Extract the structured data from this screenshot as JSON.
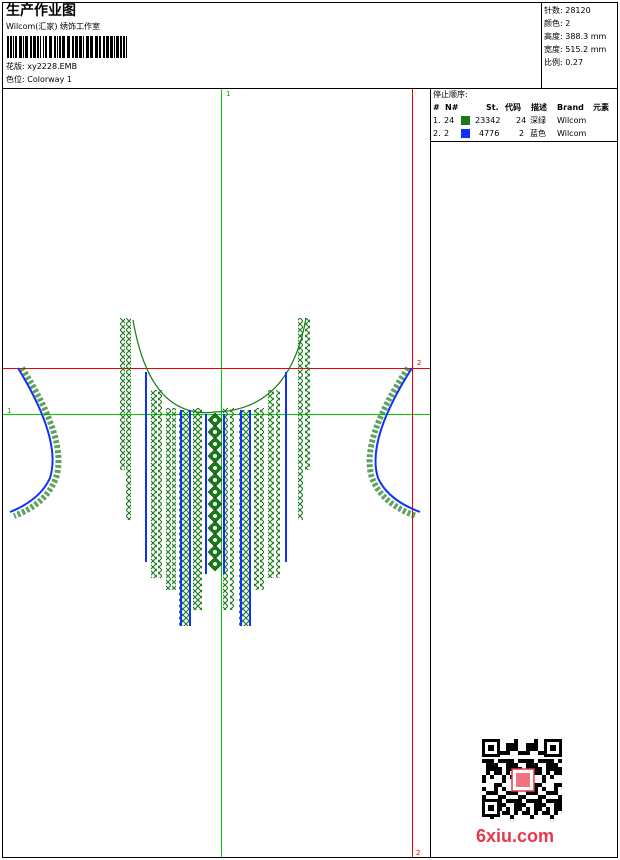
{
  "header": {
    "title": "生产作业图",
    "company": "Wilcom(汇家) 绣饰工作室",
    "design_label": "花版: ",
    "design_value": "xy2228.EMB",
    "colorway_label": "色位: ",
    "colorway_value": "Colorway 1"
  },
  "specs": [
    {
      "label": "针数:",
      "value": "28120"
    },
    {
      "label": "颜色:",
      "value": "2"
    },
    {
      "label": "高度:",
      "value": "388.3 mm"
    },
    {
      "label": "宽度:",
      "value": "515.2 mm"
    },
    {
      "label": "比例:",
      "value": "0.27"
    }
  ],
  "stop_sequence": {
    "title": "停止顺序:",
    "columns": [
      "#",
      "N#",
      "St.",
      "代码",
      "描述",
      "Brand",
      "元素"
    ],
    "rows": [
      {
        "index": "1.",
        "needle": "24",
        "swatch": "#1a7a1a",
        "stitches": "23342",
        "code": "24",
        "desc": "深绿",
        "brand": "Wilcom"
      },
      {
        "index": "2.",
        "needle": "2",
        "swatch": "#1030ff",
        "stitches": "4776",
        "code": "2",
        "desc": "蓝色",
        "brand": "Wilcom"
      }
    ]
  },
  "guides": {
    "vertical_green_label": "1",
    "horizontal_green_label": "1",
    "horizontal_red_label": "2",
    "vertical_red_label": "2"
  },
  "colors": {
    "green_thread": "#1a7a1a",
    "blue_thread": "#1030ff",
    "guide_green": "#00cc00",
    "guide_red": "#ee0000"
  },
  "watermark": {
    "text": "6xiu.com",
    "icon": "qr-code-icon"
  }
}
